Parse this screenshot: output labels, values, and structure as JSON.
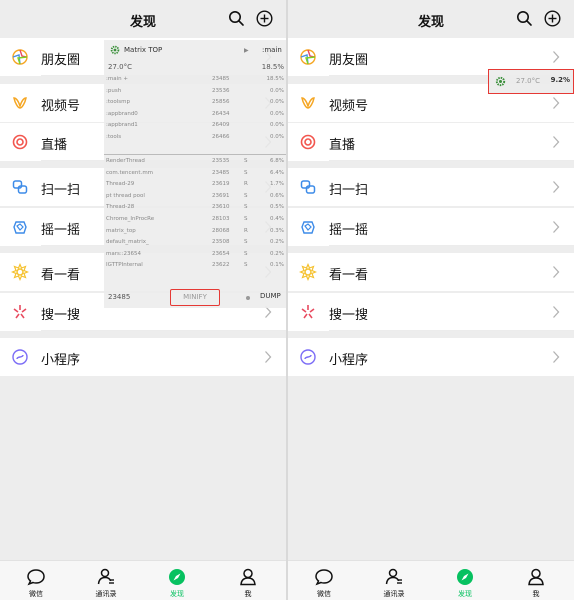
{
  "nav": {
    "title": "发现"
  },
  "menu": [
    {
      "label": "朋友圈",
      "icon": "moments-icon"
    },
    {
      "label": "视频号",
      "icon": "channels-icon"
    },
    {
      "label": "直播",
      "icon": "live-icon"
    },
    {
      "label": "扫一扫",
      "icon": "scan-icon"
    },
    {
      "label": "摇一摇",
      "icon": "shake-icon"
    },
    {
      "label": "看一看",
      "icon": "top-stories-icon"
    },
    {
      "label": "搜一搜",
      "icon": "search-discover-icon"
    },
    {
      "label": "小程序",
      "icon": "mini-programs-icon"
    }
  ],
  "tabs": [
    {
      "label": "微信",
      "icon": "chats-icon"
    },
    {
      "label": "通讯录",
      "icon": "contacts-icon"
    },
    {
      "label": "发现",
      "icon": "discover-icon",
      "active": true
    },
    {
      "label": "我",
      "icon": "me-icon"
    }
  ],
  "matrix": {
    "title": "Matrix TOP",
    "process_label": ":main",
    "temperature": "27.0°C",
    "cpu": "18.5%",
    "footer_pid": "23485",
    "minify_label": "MINIFY",
    "dump_label": "DUMP",
    "processes": [
      {
        "name": ":main +",
        "pid": "23485",
        "state": "",
        "cpu": "18.5%"
      },
      {
        "name": ":push",
        "pid": "23536",
        "state": "",
        "cpu": "0.0%"
      },
      {
        "name": ":toolsmp",
        "pid": "25856",
        "state": "",
        "cpu": "0.0%"
      },
      {
        "name": ":appbrand0",
        "pid": "26434",
        "state": "",
        "cpu": "0.0%"
      },
      {
        "name": ":appbrand1",
        "pid": "26409",
        "state": "",
        "cpu": "0.0%"
      },
      {
        "name": ":tools",
        "pid": "26466",
        "state": "",
        "cpu": "0.0%"
      }
    ],
    "threads": [
      {
        "name": "RenderThread",
        "pid": "23535",
        "state": "S",
        "cpu": "6.8%"
      },
      {
        "name": "com.tencent.mm",
        "pid": "23485",
        "state": "S",
        "cpu": "6.4%"
      },
      {
        "name": "Thread-29",
        "pid": "23619",
        "state": "R",
        "cpu": "1.7%"
      },
      {
        "name": "pt thread pool",
        "pid": "23691",
        "state": "S",
        "cpu": "0.6%"
      },
      {
        "name": "Thread-28",
        "pid": "23610",
        "state": "S",
        "cpu": "0.5%"
      },
      {
        "name": "Chrome_InProcRe",
        "pid": "28103",
        "state": "S",
        "cpu": "0.4%"
      },
      {
        "name": "matrix_top",
        "pid": "28068",
        "state": "R",
        "cpu": "0.3%"
      },
      {
        "name": "default_matrix_",
        "pid": "23508",
        "state": "S",
        "cpu": "0.2%"
      },
      {
        "name": "mars::23654",
        "pid": "23654",
        "state": "S",
        "cpu": "0.2%"
      },
      {
        "name": "IGTTPInternal",
        "pid": "23622",
        "state": "S",
        "cpu": "0.1%"
      }
    ]
  },
  "mini": {
    "temperature": "27.0°C",
    "cpu": "9.2%"
  },
  "colors": {
    "accent": "#07c160",
    "highlight": "#e53935",
    "background": "#ededed"
  }
}
